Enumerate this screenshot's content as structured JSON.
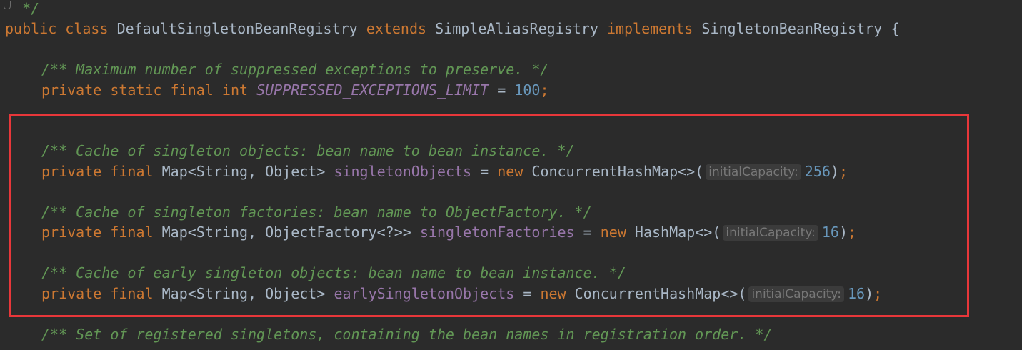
{
  "code": {
    "doc_close": "*/",
    "class_decl": {
      "kw_public": "public",
      "kw_class": "class",
      "class_name": "DefaultSingletonBeanRegistry",
      "kw_extends": "extends",
      "super_name": "SimpleAliasRegistry",
      "kw_implements": "implements",
      "iface_name": "SingletonBeanRegistry",
      "open_brace": "{"
    },
    "limit_doc": "/** Maximum number of suppressed exceptions to preserve. */",
    "limit_decl": {
      "kw_private": "private",
      "kw_static": "static",
      "kw_final": "final",
      "kw_int": "int",
      "const_name": "SUPPRESSED_EXCEPTIONS_LIMIT",
      "eq": "=",
      "value": "100",
      "semi": ";"
    },
    "singleton_doc": "/** Cache of singleton objects: bean name to bean instance. */",
    "singleton_decl": {
      "kw_private": "private",
      "kw_final": "final",
      "type": "Map<String, Object>",
      "field": "singletonObjects",
      "eq": "=",
      "kw_new": "new",
      "ctor": "ConcurrentHashMap<>(",
      "hint": "initialCapacity:",
      "value": "256",
      "close": ")",
      "semi": ";"
    },
    "factories_doc": "/** Cache of singleton factories: bean name to ObjectFactory. */",
    "factories_decl": {
      "kw_private": "private",
      "kw_final": "final",
      "type": "Map<String, ObjectFactory<?>>",
      "field": "singletonFactories",
      "eq": "=",
      "kw_new": "new",
      "ctor": "HashMap<>(",
      "hint": "initialCapacity:",
      "value": "16",
      "close": ")",
      "semi": ";"
    },
    "early_doc": "/** Cache of early singleton objects: bean name to bean instance. */",
    "early_decl": {
      "kw_private": "private",
      "kw_final": "final",
      "type": "Map<String, Object>",
      "field": "earlySingletonObjects",
      "eq": "=",
      "kw_new": "new",
      "ctor": "ConcurrentHashMap<>(",
      "hint": "initialCapacity:",
      "value": "16",
      "close": ")",
      "semi": ";"
    },
    "registered_doc": "/** Set of registered singletons, containing the bean names in registration order. */"
  },
  "colors": {
    "background": "#2b2b2b",
    "keyword": "#cc7832",
    "doc_comment": "#629755",
    "field": "#9876aa",
    "number": "#6897bb",
    "plain": "#a9b7c6",
    "highlight_border": "#e8373a"
  }
}
